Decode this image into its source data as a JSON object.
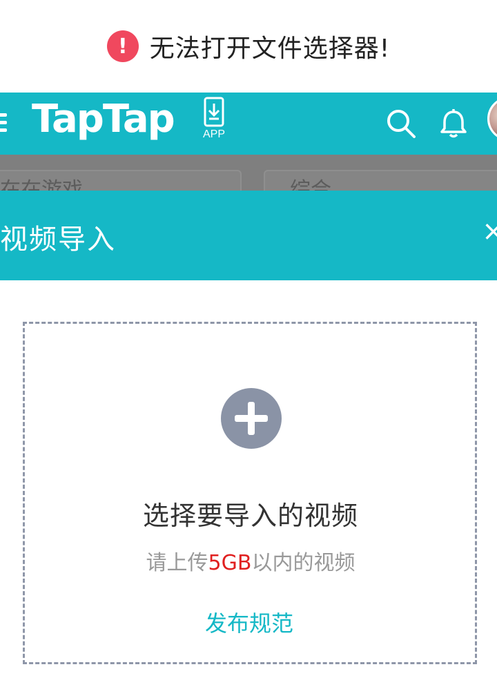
{
  "toast": {
    "icon": "exclamation-icon",
    "message": "无法打开文件选择器!"
  },
  "header": {
    "logo": "TapTap",
    "app_label": "APP",
    "brand_color": "#15b8c6"
  },
  "background": {
    "card_left_text": "在在游戏",
    "card_right_text": "综合"
  },
  "modal": {
    "title": "视频导入",
    "close": "×"
  },
  "dropzone": {
    "title": "选择要导入的视频",
    "hint_before": "请上传",
    "hint_size": "5GB",
    "hint_after": "以内的视频",
    "link": "发布规范"
  },
  "colors": {
    "accent": "#15b8c6",
    "error": "#f0485e",
    "highlight": "#e02020",
    "dashed_border": "#8e96a8"
  }
}
